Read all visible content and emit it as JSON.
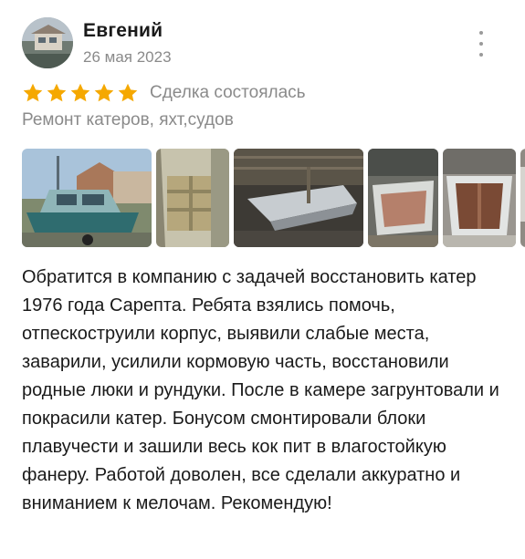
{
  "review": {
    "author_name": "Евгений",
    "date": "26 мая 2023",
    "rating": 5,
    "rating_max": 5,
    "status": "Сделка состоялась",
    "category": "Ремонт катеров, яхт,судов",
    "text": "Обратится в компанию с задачей восстановить катер 1976 года Сарепта. Ребята взялись помочь, отпескоструили корпус, выявили слабые места, заварили, усилили кормовую часть, восстановили родные люки и рундуки. После в камере загрунтовали и покрасили катер. Бонусом смонтировали блоки плавучести и зашили весь кок пит в влагостойкую фанеру. Работой доволен, все сделали аккуратно и вниманием к мелочам. Рекомендую!",
    "photo_count_visible": 6
  },
  "icons": {
    "star": "star-icon",
    "more": "more-vertical-icon"
  },
  "colors": {
    "star": "#f5a800",
    "muted_text": "#8a8a8a",
    "main_text": "#1a1a1a",
    "background": "#ffffff"
  }
}
